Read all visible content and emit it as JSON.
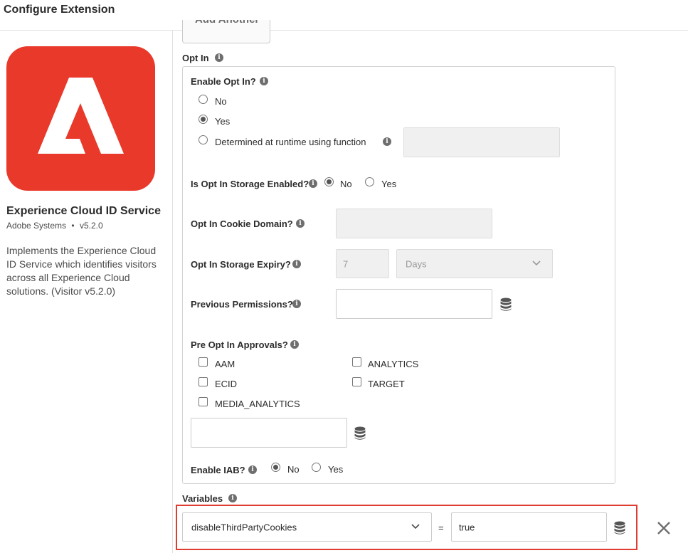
{
  "header": {
    "title": "Configure Extension"
  },
  "extension": {
    "name": "Experience Cloud ID Service",
    "vendor": "Adobe Systems",
    "separator": "•",
    "version": "v5.2.0",
    "description": "Implements the Experience Cloud ID Service which identifies visitors across all Experience Cloud solutions. (Visitor v5.2.0)",
    "logo_color": "#e8392a"
  },
  "add_button_label": "Add Another",
  "opt_in": {
    "section_label": "Opt In",
    "enable_label": "Enable Opt In?",
    "enable_options": {
      "no": "No",
      "yes": "Yes",
      "runtime": "Determined at runtime using function"
    },
    "enable_selected": "Yes",
    "runtime_function_value": "",
    "storage_enabled_label": "Is Opt In Storage Enabled?",
    "storage_options": {
      "no": "No",
      "yes": "Yes"
    },
    "storage_selected": "No",
    "cookie_domain_label": "Opt In Cookie Domain?",
    "cookie_domain_value": "",
    "storage_expiry_label": "Opt In Storage Expiry?",
    "storage_expiry_value": "7",
    "storage_expiry_unit": "Days",
    "previous_permissions_label": "Previous Permissions?",
    "previous_permissions_value": "",
    "approvals_label": "Pre Opt In Approvals?",
    "approvals": {
      "aam": "AAM",
      "analytics": "ANALYTICS",
      "ecid": "ECID",
      "target": "TARGET",
      "media_analytics": "MEDIA_ANALYTICS"
    },
    "approvals_value": "",
    "iab_label": "Enable IAB?",
    "iab_options": {
      "no": "No",
      "yes": "Yes"
    },
    "iab_selected": "No"
  },
  "variables": {
    "section_label": "Variables",
    "name": "disableThirdPartyCookies",
    "equals": "=",
    "value": "true",
    "highlight_color": "#e03c31"
  },
  "icons": {
    "info": "info-icon",
    "data_element": "database-icon",
    "remove": "close-icon",
    "dropdown": "chevron-down-icon"
  }
}
